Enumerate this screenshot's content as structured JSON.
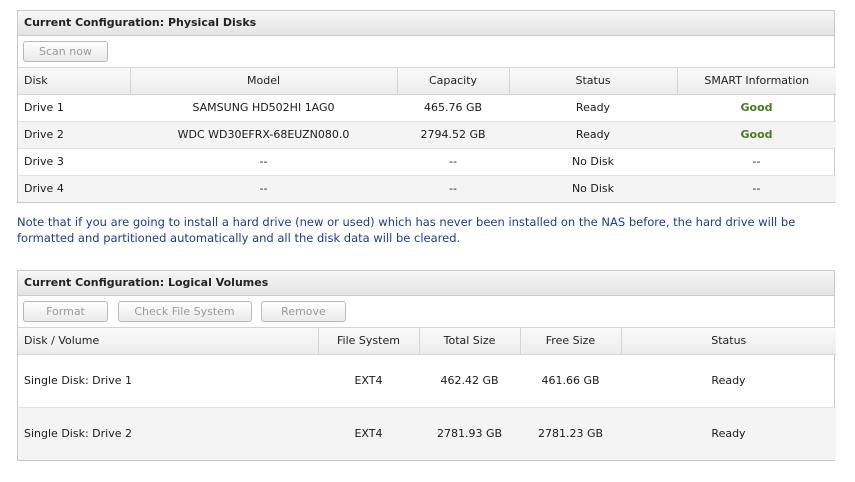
{
  "physical": {
    "title": "Current Configuration: Physical Disks",
    "scan_label": "Scan now",
    "headers": [
      "Disk",
      "Model",
      "Capacity",
      "Status",
      "SMART Information"
    ],
    "rows": [
      [
        "Drive 1",
        "SAMSUNG HD502HI 1AG0",
        "465.76 GB",
        "Ready",
        "Good"
      ],
      [
        "Drive 2",
        "WDC WD30EFRX-68EUZN080.0",
        "2794.52 GB",
        "Ready",
        "Good"
      ],
      [
        "Drive 3",
        "--",
        "--",
        "No Disk",
        "--"
      ],
      [
        "Drive 4",
        "--",
        "--",
        "No Disk",
        "--"
      ]
    ]
  },
  "note": "Note that if you are going to install a hard drive (new or used) which has never been installed on the NAS before, the hard drive will be formatted and partitioned automatically and all the disk data will be cleared.",
  "logical": {
    "title": "Current Configuration: Logical Volumes",
    "format_label": "Format",
    "check_label": "Check File System",
    "remove_label": "Remove",
    "headers": [
      "Disk / Volume",
      "File System",
      "Total Size",
      "Free Size",
      "Status"
    ],
    "rows": [
      [
        "Single Disk: Drive 1",
        "EXT4",
        "462.42 GB",
        "461.66 GB",
        "Ready"
      ],
      [
        "Single Disk: Drive 2",
        "EXT4",
        "2781.93 GB",
        "2781.23 GB",
        "Ready"
      ]
    ]
  },
  "colors": {
    "good": "#4a7c1f",
    "note": "#1c3d8c"
  }
}
